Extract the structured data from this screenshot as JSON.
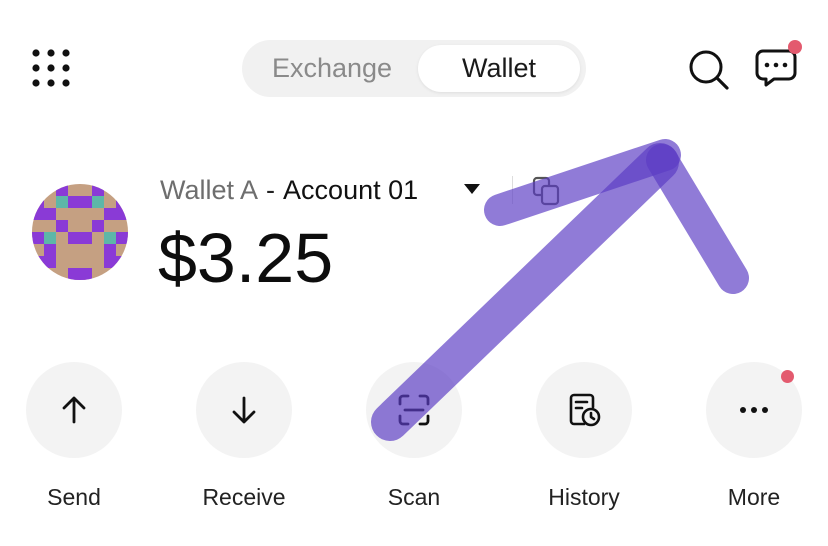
{
  "header": {
    "tabs": [
      {
        "label": "Exchange",
        "active": false
      },
      {
        "label": "Wallet",
        "active": true
      }
    ],
    "icons": [
      "grid-menu-icon",
      "search-icon",
      "chat-icon"
    ],
    "has_notification": true
  },
  "account": {
    "wallet_name": "Wallet A",
    "separator": "-",
    "account_name": "Account 01",
    "balance": "$3.25"
  },
  "actions": [
    {
      "label": "Send",
      "icon": "arrow-up-icon"
    },
    {
      "label": "Receive",
      "icon": "arrow-down-icon"
    },
    {
      "label": "Scan",
      "icon": "scan-icon"
    },
    {
      "label": "History",
      "icon": "history-icon"
    },
    {
      "label": "More",
      "icon": "more-icon",
      "has_notification": true
    }
  ],
  "colors": {
    "notification_dot": "#e35a6e",
    "annotation_arrow": "#5b3cc4",
    "tab_track": "#f1f1f1",
    "action_circle": "#f3f3f3"
  }
}
